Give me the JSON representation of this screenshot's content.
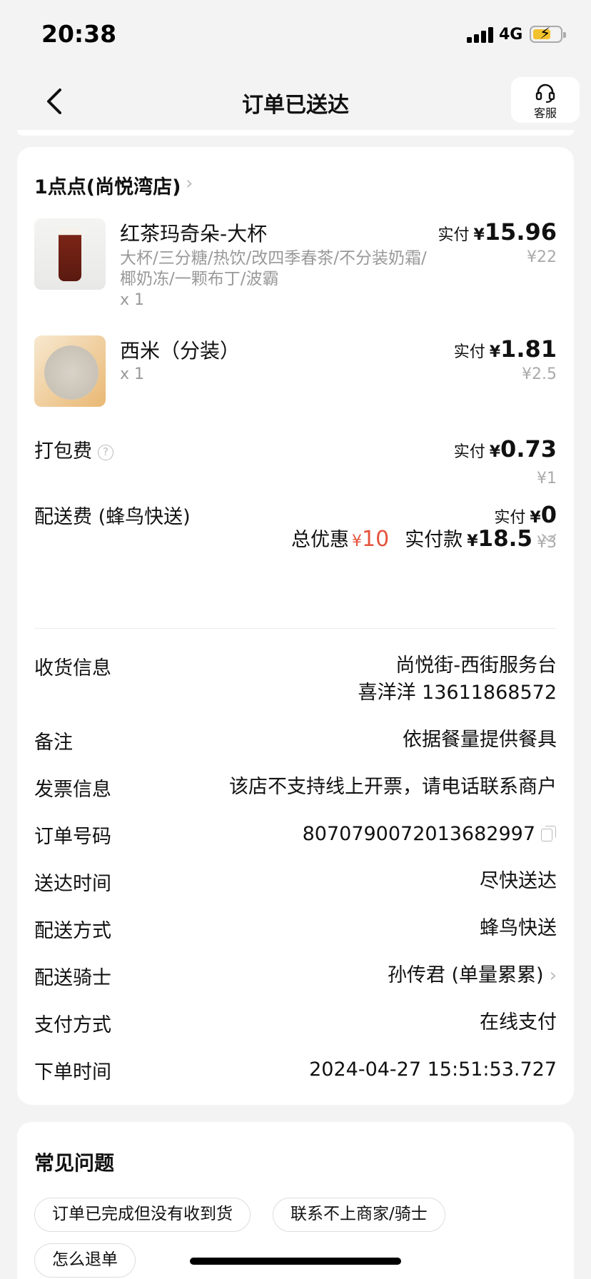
{
  "status_bar": {
    "time": "20:38",
    "network": "4G"
  },
  "nav": {
    "title": "订单已送达",
    "service_label": "客服"
  },
  "store": {
    "name": "1点点(尚悦湾店)"
  },
  "items": [
    {
      "name": "红茶玛奇朵-大杯",
      "spec": "大杯/三分糖/热饮/改四季春茶/不分装奶霜/椰奶冻/一颗布丁/波霸",
      "qty": "x 1",
      "paid_label": "实付",
      "currency": "¥",
      "paid": "15.96",
      "original": "¥22"
    },
    {
      "name": "西米（分装）",
      "qty": "x 1",
      "paid_label": "实付",
      "currency": "¥",
      "paid": "1.81",
      "original": "¥2.5"
    }
  ],
  "fees": [
    {
      "label": "打包费",
      "paid_label": "实付",
      "currency": "¥",
      "paid": "0.73",
      "original": "¥1"
    },
    {
      "label": "配送费 (蜂鸟快送)",
      "paid_label": "实付",
      "currency": "¥",
      "paid": "0",
      "original": "¥3"
    }
  ],
  "totals": {
    "discount_label": "总优惠",
    "discount_currency": "¥",
    "discount": "10",
    "paid_label": "实付款",
    "currency": "¥",
    "paid": "18.5"
  },
  "info": {
    "address_label": "收货信息",
    "address_line1": "尚悦街-西街服务台",
    "address_line2": "喜洋洋 13611868572",
    "note_label": "备注",
    "note": "依据餐量提供餐具",
    "invoice_label": "发票信息",
    "invoice": "该店不支持线上开票，请电话联系商户",
    "order_no_label": "订单号码",
    "order_no": "8070790072013682997",
    "delivery_time_label": "送达时间",
    "delivery_time": "尽快送达",
    "delivery_method_label": "配送方式",
    "delivery_method": "蜂鸟快送",
    "rider_label": "配送骑士",
    "rider": "孙传君 (单量累累)",
    "payment_label": "支付方式",
    "payment": "在线支付",
    "order_time_label": "下单时间",
    "order_time": "2024-04-27 15:51:53.727"
  },
  "faq": {
    "title": "常见问题",
    "chips": [
      "订单已完成但没有收到货",
      "联系不上商家/骑士",
      "怎么退单"
    ]
  },
  "colors": {
    "accent_red": "#e5533c",
    "background": "#f3f3f3",
    "battery": "#f2c12e"
  }
}
